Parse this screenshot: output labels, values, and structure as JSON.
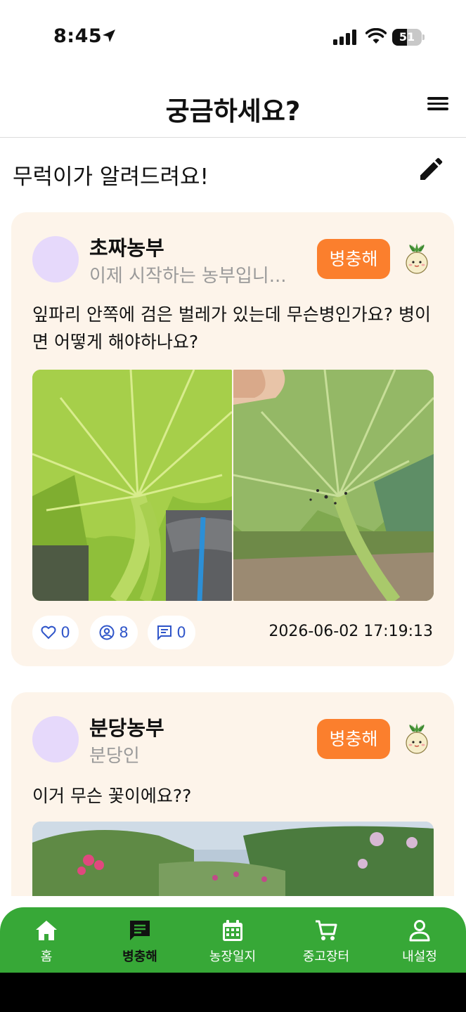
{
  "status_bar": {
    "time": "8:45",
    "battery_level": "51",
    "battery_fraction": 0.51
  },
  "header": {
    "title": "궁금하세요?",
    "menu_icon": "hamburger-menu-icon"
  },
  "subheader": {
    "title": "무럭이가 알려드려요!",
    "edit_icon": "pencil-icon"
  },
  "posts": [
    {
      "author_name": "초짜농부",
      "author_bio": "이제 시작하는 농부입니...",
      "category": "병충해",
      "text": "잎파리 안쪽에 검은 벌레가 있는데 무슨병인가요? 병이면 어떻게 해야하나요?",
      "likes": "0",
      "views": "8",
      "comments": "0",
      "date": "2026-06-02 17:19:13"
    },
    {
      "author_name": "분당농부",
      "author_bio": "분당인",
      "category": "병충해",
      "text": "이거 무슨 꽃이에요??"
    }
  ],
  "tabbar": {
    "items": [
      {
        "label": "홈",
        "icon": "home-icon"
      },
      {
        "label": "병충해",
        "icon": "message-icon"
      },
      {
        "label": "농장일지",
        "icon": "calendar-icon"
      },
      {
        "label": "중고장터",
        "icon": "cart-icon"
      },
      {
        "label": "내설정",
        "icon": "user-icon"
      }
    ],
    "active": "병충해"
  },
  "colors": {
    "brand_green": "#37a837",
    "badge_orange": "#fb7f2d",
    "card_bg": "#fdf4ea",
    "avatar_bg": "#e6d9fb",
    "stat_blue": "#2f55c9"
  }
}
